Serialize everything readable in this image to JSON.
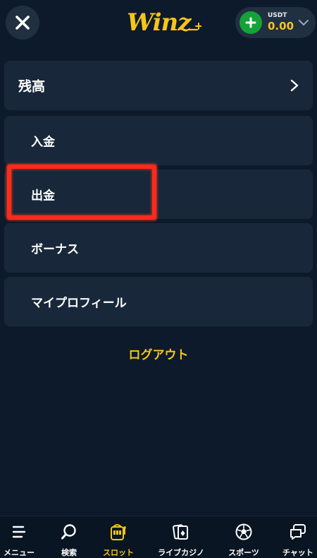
{
  "header": {
    "logo_text": "Winz",
    "wallet": {
      "currency": "USDT",
      "amount": "0.00"
    }
  },
  "menu": {
    "balance_label": "残高",
    "items": [
      {
        "label": "入金"
      },
      {
        "label": "出金"
      },
      {
        "label": "ボーナス"
      },
      {
        "label": "マイプロフィール"
      }
    ],
    "logout_label": "ログアウト"
  },
  "bottom_nav": {
    "items": [
      {
        "label": "メニュー",
        "icon": "menu-icon"
      },
      {
        "label": "検索",
        "icon": "search-icon"
      },
      {
        "label": "スロット",
        "icon": "slot-machine-icon",
        "active": true
      },
      {
        "label": "ライブカジノ",
        "icon": "cards-icon"
      },
      {
        "label": "スポーツ",
        "icon": "soccer-ball-icon"
      },
      {
        "label": "チャット",
        "icon": "chat-icon"
      }
    ]
  },
  "colors": {
    "background": "#0d1a2b",
    "card": "#18283a",
    "accent": "#f5c518",
    "add_button": "#14a338",
    "highlight_annotation": "#ff2a1a"
  }
}
